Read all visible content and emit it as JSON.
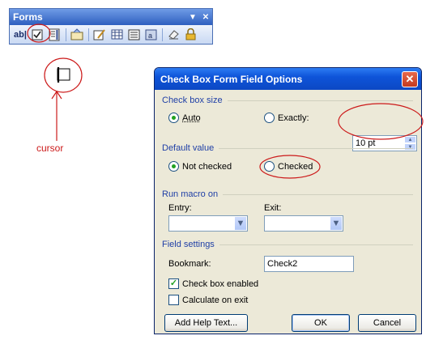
{
  "toolbar": {
    "title": "Forms",
    "buttons": [
      {
        "name": "text-form-field-button",
        "label": "ab|",
        "icon": "text-field-icon"
      },
      {
        "name": "check-box-form-field-button",
        "icon": "checkbox-icon"
      },
      {
        "name": "drop-down-form-field-button",
        "icon": "dropdown-field-icon"
      },
      {
        "name": "form-field-options-button",
        "icon": "options-icon"
      },
      {
        "name": "draw-table-button",
        "icon": "pencil-table-icon"
      },
      {
        "name": "insert-table-button",
        "icon": "table-icon"
      },
      {
        "name": "insert-frame-button",
        "icon": "frame-icon"
      },
      {
        "name": "form-field-shading-button",
        "icon": "shading-icon"
      },
      {
        "name": "reset-form-fields-button",
        "icon": "eraser-icon"
      },
      {
        "name": "protect-form-button",
        "icon": "lock-icon"
      }
    ]
  },
  "annotation": {
    "cursor_label": "cursor",
    "color": "#cc1a1a"
  },
  "dialog": {
    "title": "Check Box Form Field Options",
    "check_box_size": {
      "group_label": "Check box size",
      "auto_label": "Auto",
      "exactly_label": "Exactly:",
      "selected": "auto",
      "exact_value": "10 pt"
    },
    "default_value": {
      "group_label": "Default value",
      "not_checked_label": "Not checked",
      "checked_label": "Checked",
      "selected": "not_checked"
    },
    "run_macro_on": {
      "group_label": "Run macro on",
      "entry_label": "Entry:",
      "exit_label": "Exit:",
      "entry_value": "",
      "exit_value": ""
    },
    "field_settings": {
      "group_label": "Field settings",
      "bookmark_label": "Bookmark:",
      "bookmark_value": "Check2",
      "check_box_enabled_label": "Check box enabled",
      "check_box_enabled": true,
      "calculate_on_exit_label": "Calculate on exit",
      "calculate_on_exit": false
    },
    "buttons": {
      "add_help_text": "Add Help Text...",
      "ok": "OK",
      "cancel": "Cancel"
    }
  },
  "colors": {
    "accent_blue": "#0e54d9",
    "dialog_bg": "#ece9d8",
    "group_label": "#1f3fa6",
    "radio_dot": "#21a121"
  }
}
